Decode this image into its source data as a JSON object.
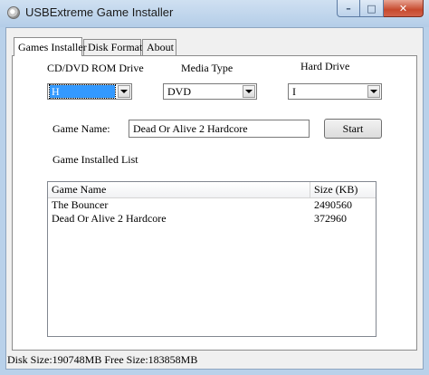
{
  "window": {
    "title": "USBExtreme Game Installer",
    "caption_buttons": {
      "minimize": "–",
      "maximize": "□",
      "close": "✕"
    }
  },
  "tabs": [
    {
      "label": "Games Installer",
      "active": true
    },
    {
      "label": "Disk Format",
      "active": false
    },
    {
      "label": "About",
      "active": false
    }
  ],
  "drives": {
    "cdrom_label": "CD/DVD ROM Drive",
    "cdrom_value": "H",
    "media_label": "Media Type",
    "media_value": "DVD",
    "hard_label": "Hard Drive",
    "hard_value": "I"
  },
  "game": {
    "name_label": "Game Name:",
    "name_value": "Dead Or Alive 2 Hardcore",
    "start_label": "Start"
  },
  "installed_list": {
    "label": "Game Installed List",
    "columns": [
      "Game Name",
      "Size (KB)"
    ],
    "rows": [
      {
        "name": "The Bouncer",
        "size": "2490560"
      },
      {
        "name": "Dead Or Alive 2 Hardcore",
        "size": "372960"
      }
    ]
  },
  "status": {
    "text": "Disk Size:190748MB Free Size:183858MB"
  },
  "colors": {
    "selection": "#3399ff",
    "close_button": "#c74a2e",
    "frame": "#b9d1ea"
  }
}
